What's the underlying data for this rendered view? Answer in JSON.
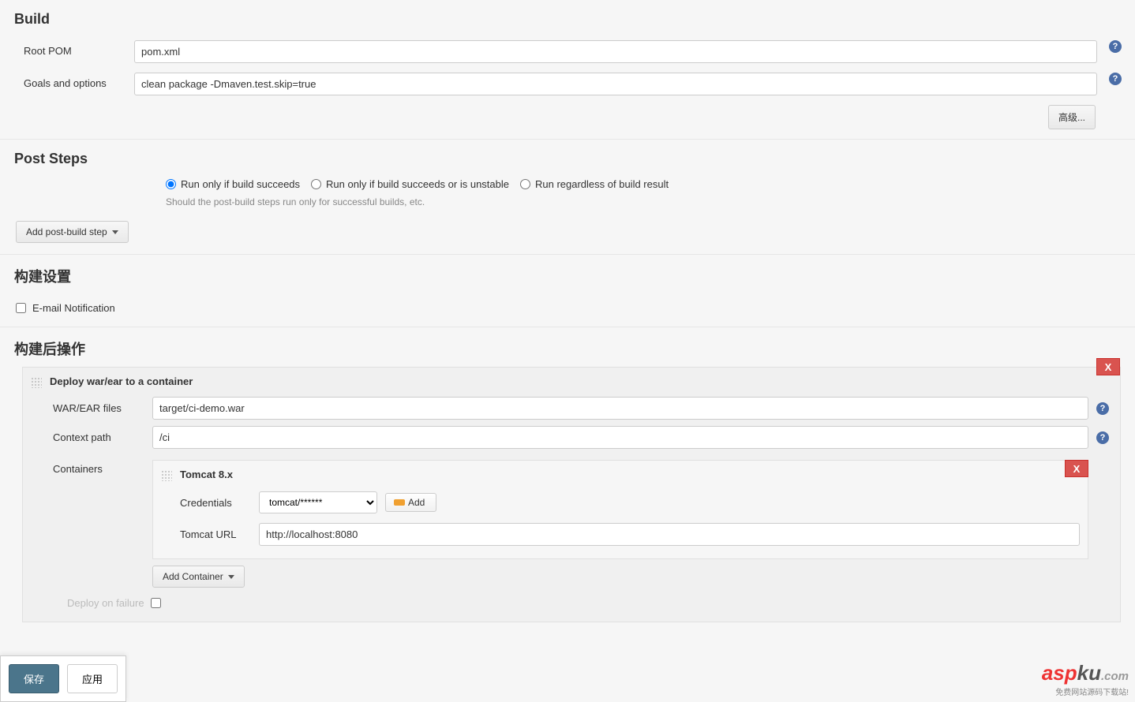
{
  "sections": {
    "build": "Build",
    "post_steps": "Post Steps",
    "build_settings": "构建设置",
    "post_build_actions": "构建后操作"
  },
  "build": {
    "root_pom_label": "Root POM",
    "root_pom_value": "pom.xml",
    "goals_label": "Goals and options",
    "goals_value": "clean package -Dmaven.test.skip=true",
    "advanced_btn": "高级..."
  },
  "post_steps": {
    "radio1": "Run only if build succeeds",
    "radio2": "Run only if build succeeds or is unstable",
    "radio3": "Run regardless of build result",
    "hint": "Should the post-build steps run only for successful builds, etc.",
    "add_step_btn": "Add post-build step"
  },
  "build_settings": {
    "email_notification": "E-mail Notification"
  },
  "deploy": {
    "title": "Deploy war/ear to a container",
    "close": "X",
    "war_label": "WAR/EAR files",
    "war_value": "target/ci-demo.war",
    "context_label": "Context path",
    "context_value": "/ci",
    "containers_label": "Containers",
    "container": {
      "title": "Tomcat 8.x",
      "close": "X",
      "credentials_label": "Credentials",
      "credentials_value": "tomcat/******",
      "add_btn": "Add",
      "url_label": "Tomcat URL",
      "url_value": "http://localhost:8080"
    },
    "add_container_btn": "Add Container",
    "deploy_on_failure": "Deploy on failure"
  },
  "bottom": {
    "save": "保存",
    "apply": "应用"
  },
  "watermark": {
    "brand_a": "asp",
    "brand_b": "ku",
    "brand_c": ".com",
    "tag": "免费网站源码下载站!"
  }
}
